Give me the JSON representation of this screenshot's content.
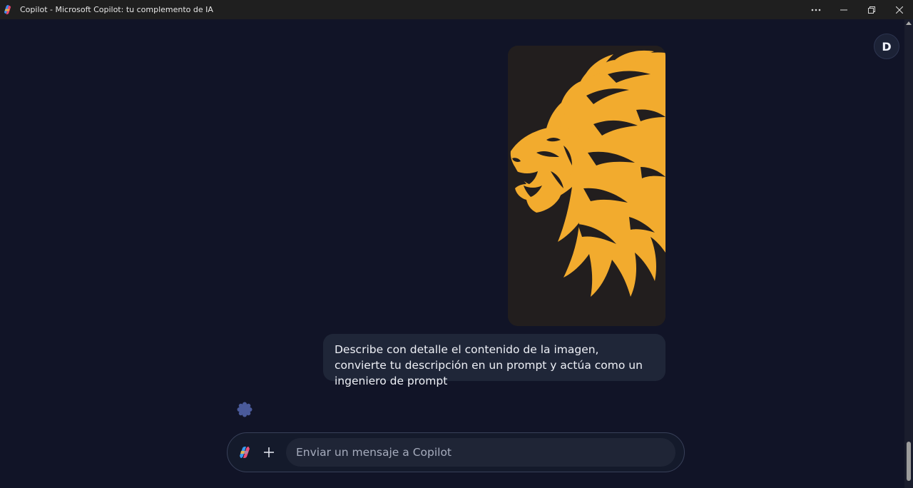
{
  "window": {
    "title": "Copilot - Microsoft Copilot: tu complemento de IA",
    "controls": [
      "more-options-icon",
      "minimize-icon",
      "restore-icon",
      "close-icon"
    ]
  },
  "header": {
    "avatar_initial": "D"
  },
  "conversation": {
    "attachment": {
      "type": "image",
      "description_icon": "lion-illustration",
      "colors": {
        "background": "#221e1e",
        "lion": "#f2ab2e"
      }
    },
    "user_message": "Describe con detalle el contenido de la imagen, convierte tu descripción en un prompt y actúa como un ingeniero de prompt",
    "assistant_status_icon": "thinking-spinner-icon"
  },
  "composer": {
    "placeholder": "Enviar un mensaje a Copilot",
    "value": "",
    "copilot_icon": "copilot-logo-icon",
    "add_icon": "plus-icon"
  },
  "colors": {
    "background": "#111427",
    "bubble": "#1f2638",
    "accent_lion": "#f2ab2e"
  }
}
